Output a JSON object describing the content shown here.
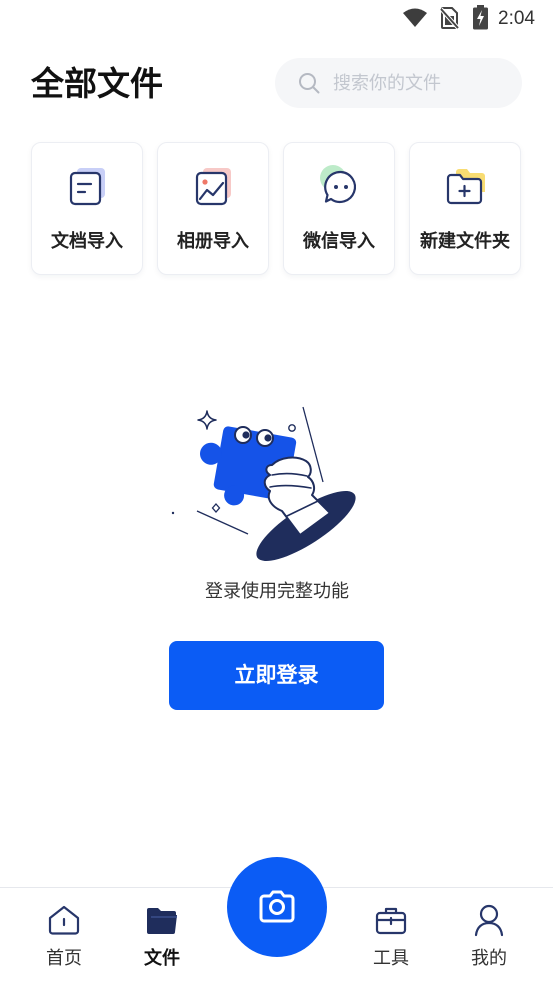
{
  "status_bar": {
    "time": "2:04",
    "icons": [
      "wifi-icon",
      "no-sim-icon",
      "battery-charging-icon"
    ]
  },
  "header": {
    "title": "全部文件",
    "search": {
      "placeholder": "搜索你的文件",
      "icon": "search-icon"
    }
  },
  "quick_actions": [
    {
      "label": "文档导入",
      "icon": "document-import-icon"
    },
    {
      "label": "相册导入",
      "icon": "album-import-icon"
    },
    {
      "label": "微信导入",
      "icon": "wechat-import-icon"
    },
    {
      "label": "新建文件夹",
      "icon": "new-folder-icon"
    }
  ],
  "empty_state": {
    "illustration": "puzzle-hand-illustration",
    "message": "登录使用完整功能",
    "login_button": "立即登录"
  },
  "bottom_nav": {
    "items": [
      {
        "label": "首页",
        "icon": "home-icon",
        "active": false
      },
      {
        "label": "文件",
        "icon": "folder-icon",
        "active": true
      },
      {
        "label": "工具",
        "icon": "toolbox-icon",
        "active": false
      },
      {
        "label": "我的",
        "icon": "user-icon",
        "active": false
      }
    ],
    "center_button": {
      "icon": "camera-icon"
    }
  },
  "colors": {
    "accent": "#0b5cf5",
    "navy": "#1f2d5c",
    "puzzle_blue": "#1553e8",
    "text": "#222222",
    "placeholder": "#c3c7cf"
  }
}
